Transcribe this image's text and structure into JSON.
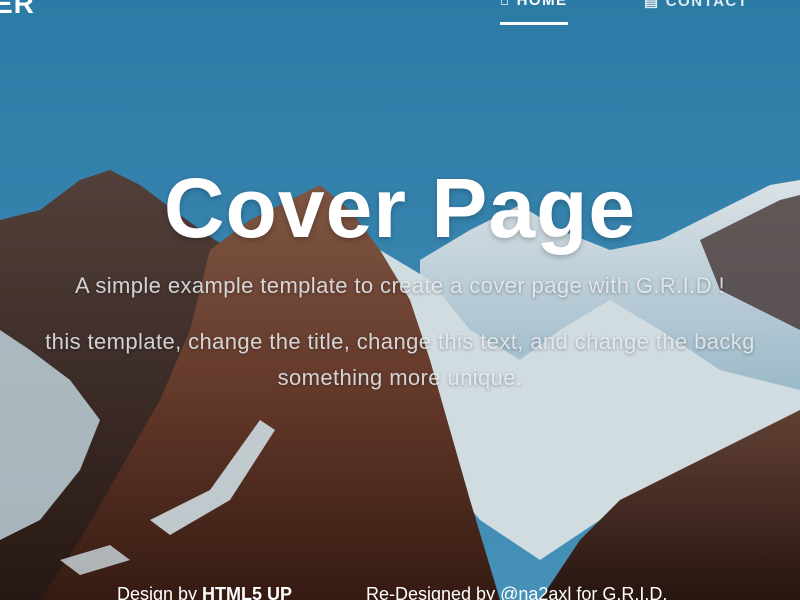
{
  "header": {
    "brand": "ER",
    "nav": [
      {
        "label": "HOME",
        "icon": "home-icon",
        "active": true
      },
      {
        "label": "CONTACT",
        "icon": "contact-icon",
        "active": false
      }
    ]
  },
  "hero": {
    "title": "Cover Page",
    "subtitle": "A simple example template to create a cover page with G.R.I.D !",
    "body_line_1": "this template, change the title, change this text, and change the backg",
    "body_line_2": "something more unique."
  },
  "footer": {
    "design_prefix": "Design by ",
    "design_link": "HTML5 UP",
    "redesign_prefix": "Re-Designed by ",
    "redesign_link": "@na2axl",
    "redesign_suffix": " for G.R.I.D."
  },
  "colors": {
    "sky": "#3a8fbd",
    "text": "#ffffff",
    "muted_text": "#e8eef3"
  }
}
